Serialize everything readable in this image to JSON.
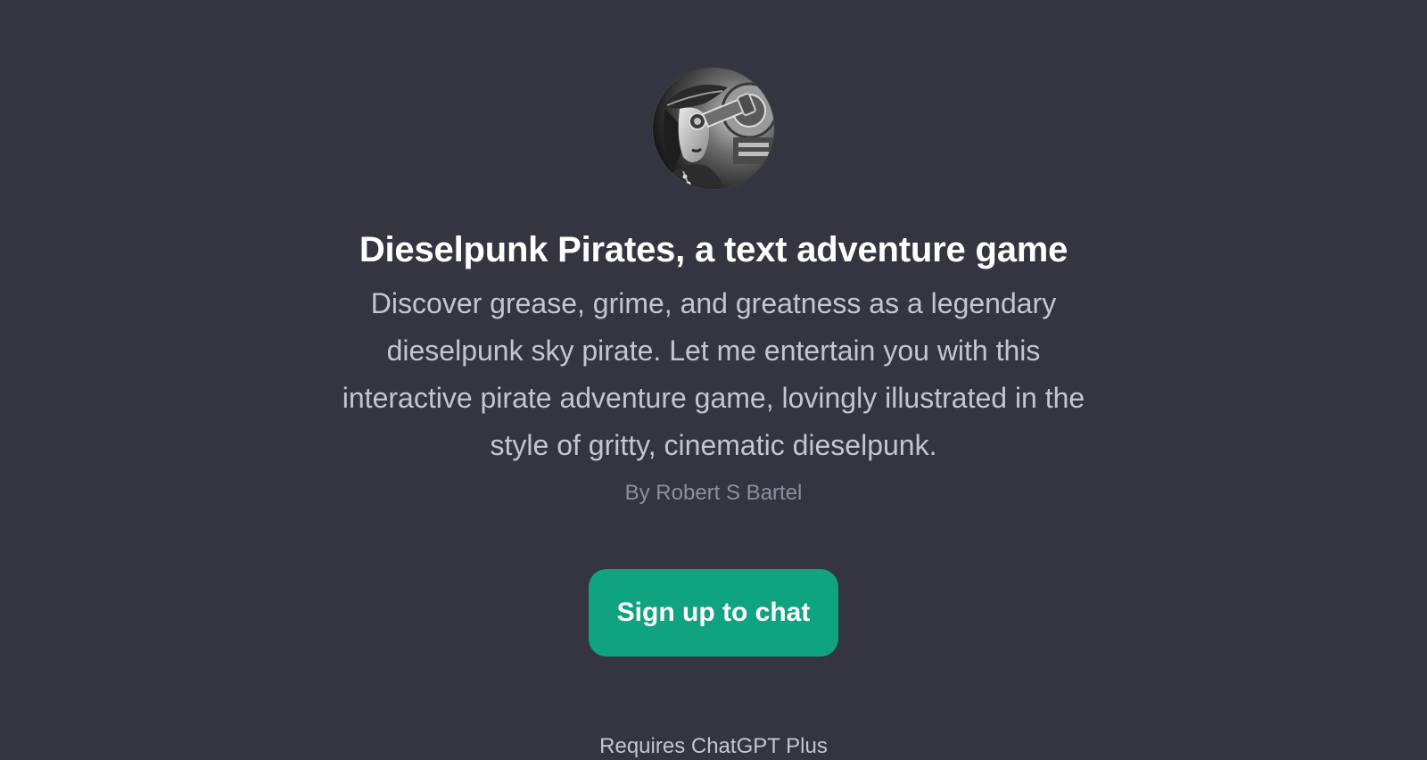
{
  "gpt": {
    "avatar_icon": "dieselpunk-pirate-portrait",
    "title": "Dieselpunk Pirates, a text adventure game",
    "description": "Discover grease, grime, and greatness as a legendary dieselpunk sky pirate. Let me entertain you with this interactive pirate adventure game, lovingly illustrated in the style of gritty, cinematic dieselpunk.",
    "byline": "By Robert S Bartel"
  },
  "actions": {
    "signup_label": "Sign up to chat"
  },
  "footer": {
    "note": "Requires ChatGPT Plus"
  },
  "colors": {
    "background": "#343541",
    "accent": "#10a37f",
    "title": "#ffffff",
    "body_text": "#c5c5d2",
    "muted_text": "#8e8ea0"
  }
}
